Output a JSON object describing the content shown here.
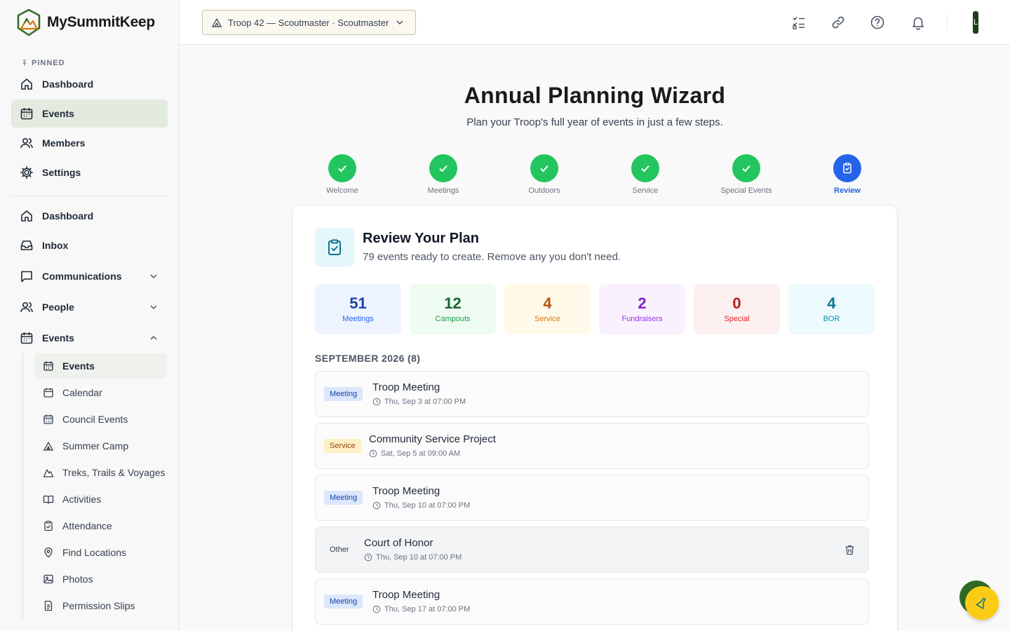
{
  "brand": {
    "name": "MySummitKeep"
  },
  "sidebar": {
    "pinned_label": "PINNED",
    "pinned": [
      {
        "label": "Dashboard",
        "icon": "home-icon"
      },
      {
        "label": "Events",
        "icon": "calendar-icon",
        "active": true
      },
      {
        "label": "Members",
        "icon": "users-icon"
      },
      {
        "label": "Settings",
        "icon": "gear-icon"
      }
    ],
    "main": [
      {
        "label": "Dashboard",
        "icon": "home-icon"
      },
      {
        "label": "Inbox",
        "icon": "inbox-icon"
      },
      {
        "label": "Communications",
        "icon": "message-icon",
        "chevron": "down"
      },
      {
        "label": "People",
        "icon": "users-icon",
        "chevron": "down"
      },
      {
        "label": "Events",
        "icon": "calendar-icon",
        "chevron": "up"
      }
    ],
    "events_sub": [
      {
        "label": "Events",
        "icon": "calendar-icon",
        "active": true
      },
      {
        "label": "Calendar",
        "icon": "calendar-outline-icon"
      },
      {
        "label": "Council Events",
        "icon": "calendar-grid-icon"
      },
      {
        "label": "Summer Camp",
        "icon": "tent-icon"
      },
      {
        "label": "Treks, Trails & Voyages",
        "icon": "mountain-icon"
      },
      {
        "label": "Activities",
        "icon": "book-icon"
      },
      {
        "label": "Attendance",
        "icon": "clipboard-check-icon"
      },
      {
        "label": "Find Locations",
        "icon": "map-pin-icon"
      },
      {
        "label": "Photos",
        "icon": "image-icon"
      },
      {
        "label": "Permission Slips",
        "icon": "document-icon"
      }
    ]
  },
  "topbar": {
    "troop_selector": "Troop 42 — Scoutmaster · Scoutmaster",
    "icons": [
      "checklist-icon",
      "link-icon",
      "help-icon",
      "bell-icon"
    ],
    "avatar_initial": "L"
  },
  "wizard": {
    "title": "Annual Planning Wizard",
    "subtitle": "Plan your Troop's full year of events in just a few steps.",
    "steps": [
      {
        "label": "Welcome",
        "status": "complete"
      },
      {
        "label": "Meetings",
        "status": "complete"
      },
      {
        "label": "Outdoors",
        "status": "complete"
      },
      {
        "label": "Service",
        "status": "complete"
      },
      {
        "label": "Special Events",
        "status": "complete"
      },
      {
        "label": "Review",
        "status": "current"
      }
    ]
  },
  "review": {
    "title": "Review Your Plan",
    "subtitle": "79 events ready to create. Remove any you don't need.",
    "stats": [
      {
        "value": "51",
        "label": "Meetings",
        "bg": "#eef4ff",
        "fg": "#1e40af",
        "sub": "#2563eb"
      },
      {
        "value": "12",
        "label": "Campouts",
        "bg": "#eefbf1",
        "fg": "#166534",
        "sub": "#16a34a"
      },
      {
        "value": "4",
        "label": "Service",
        "bg": "#fff9ea",
        "fg": "#b45309",
        "sub": "#d97706"
      },
      {
        "value": "2",
        "label": "Fundraisers",
        "bg": "#f9f2fe",
        "fg": "#7e22ce",
        "sub": "#9333ea"
      },
      {
        "value": "0",
        "label": "Special",
        "bg": "#fdf0f1",
        "fg": "#b91c1c",
        "sub": "#dc2626"
      },
      {
        "value": "4",
        "label": "BOR",
        "bg": "#edfafd",
        "fg": "#0e7490",
        "sub": "#0891b2"
      }
    ],
    "month_heading": "SEPTEMBER 2026 (8)",
    "events": [
      {
        "badge": "Meeting",
        "badge_bg": "#dbe7fd",
        "badge_fg": "#1e40af",
        "title": "Troop Meeting",
        "when": "Thu, Sep 3 at 07:00 PM"
      },
      {
        "badge": "Service",
        "badge_bg": "#fdf0c4",
        "badge_fg": "#92400e",
        "title": "Community Service Project",
        "when": "Sat, Sep 5 at 09:00 AM"
      },
      {
        "badge": "Meeting",
        "badge_bg": "#dbe7fd",
        "badge_fg": "#1e40af",
        "title": "Troop Meeting",
        "when": "Thu, Sep 10 at 07:00 PM"
      },
      {
        "badge": "Other",
        "badge_bg": "transparent",
        "badge_fg": "#374151",
        "title": "Court of Honor",
        "when": "Thu, Sep 10 at 07:00 PM",
        "hover": true
      },
      {
        "badge": "Meeting",
        "badge_bg": "#dbe7fd",
        "badge_fg": "#1e40af",
        "title": "Troop Meeting",
        "when": "Thu, Sep 17 at 07:00 PM"
      }
    ]
  },
  "fab": {
    "icon": "flask-icon"
  }
}
